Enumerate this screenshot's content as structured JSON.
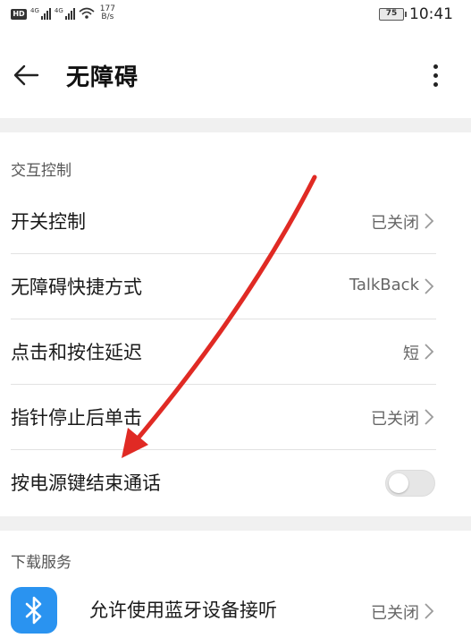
{
  "status_bar": {
    "signal1_label": "4G",
    "signal2_label": "4G",
    "wifi_label": "1",
    "net_speed_value": "177",
    "net_speed_unit": "B/s",
    "battery": "75",
    "time": "10:41"
  },
  "header": {
    "title": "无障碍"
  },
  "sections": {
    "interaction": {
      "title": "交互控制",
      "items": [
        {
          "label": "开关控制",
          "value": "已关闭"
        },
        {
          "label": "无障碍快捷方式",
          "value": "TalkBack"
        },
        {
          "label": "点击和按住延迟",
          "value": "短"
        },
        {
          "label": "指针停止后单击",
          "value": "已关闭"
        }
      ],
      "toggle_item": {
        "label": "按电源键结束通话",
        "checked": false
      }
    },
    "download": {
      "title": "下载服务",
      "items": [
        {
          "label": "允许使用蓝牙设备接听",
          "value": "已关闭",
          "icon": "bluetooth-icon"
        }
      ]
    }
  },
  "colors": {
    "annotation_arrow": "#e02a24",
    "bluetooth_bg": "#2a93f0"
  }
}
